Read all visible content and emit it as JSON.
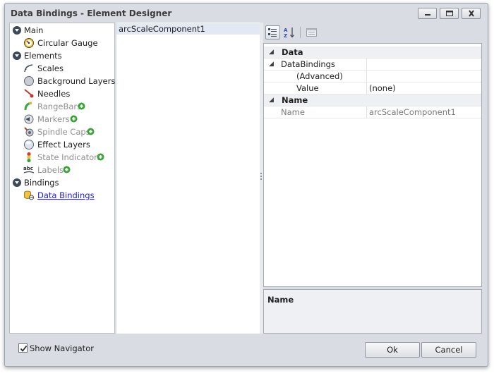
{
  "window": {
    "title": "Data Bindings - Element Designer"
  },
  "titlebar_buttons": [
    {
      "name": "minimize-icon"
    },
    {
      "name": "maximize-icon"
    },
    {
      "name": "close-icon"
    }
  ],
  "navigator": {
    "sections": [
      {
        "label": "Main",
        "items": [
          {
            "label": "Circular Gauge",
            "icon": "circular-gauge-icon",
            "disabled": false,
            "addable": false,
            "link": false
          }
        ]
      },
      {
        "label": "Elements",
        "items": [
          {
            "label": "Scales",
            "icon": "scale-arc-icon",
            "disabled": false,
            "addable": false,
            "link": false
          },
          {
            "label": "Background Layers",
            "icon": "background-layer-icon",
            "disabled": false,
            "addable": false,
            "link": false
          },
          {
            "label": "Needles",
            "icon": "needle-icon",
            "disabled": false,
            "addable": false,
            "link": false
          },
          {
            "label": "RangeBars",
            "icon": "range-bar-icon",
            "disabled": true,
            "addable": true,
            "link": false
          },
          {
            "label": "Markers",
            "icon": "marker-icon",
            "disabled": true,
            "addable": true,
            "link": false
          },
          {
            "label": "Spindle Caps",
            "icon": "spindle-cap-icon",
            "disabled": true,
            "addable": true,
            "link": false
          },
          {
            "label": "Effect Layers",
            "icon": "effect-layer-icon",
            "disabled": false,
            "addable": false,
            "link": false
          },
          {
            "label": "State Indicators",
            "icon": "state-indicator-icon",
            "disabled": true,
            "addable": true,
            "link": false
          },
          {
            "label": "Labels",
            "icon": "labels-abc-icon",
            "disabled": true,
            "addable": true,
            "link": false
          }
        ]
      },
      {
        "label": "Bindings",
        "items": [
          {
            "label": "Data Bindings",
            "icon": "data-binding-icon",
            "disabled": false,
            "addable": false,
            "link": true
          }
        ]
      }
    ]
  },
  "element_list": {
    "items": [
      "arcScaleComponent1"
    ],
    "selected": "arcScaleComponent1"
  },
  "property_toolbar": {
    "buttons": [
      {
        "name": "categorized-view-icon",
        "active": true
      },
      {
        "name": "alphabetical-sort-icon",
        "active": false
      },
      {
        "name": "property-pages-icon",
        "active": false
      }
    ]
  },
  "property_grid": {
    "rows": [
      {
        "type": "category",
        "label": "Data"
      },
      {
        "type": "group",
        "label": "DataBindings",
        "value": ""
      },
      {
        "type": "property",
        "label": "(Advanced)",
        "value": "",
        "indent": true
      },
      {
        "type": "property",
        "label": "Value",
        "value": "(none)",
        "indent": true
      },
      {
        "type": "category",
        "label": "Name"
      },
      {
        "type": "readonly",
        "label": "Name",
        "value": "arcScaleComponent1"
      }
    ]
  },
  "description": {
    "title": "Name"
  },
  "footer": {
    "show_navigator_label": "Show Navigator",
    "show_navigator_checked": true,
    "ok_label": "Ok",
    "cancel_label": "Cancel"
  },
  "colors": {
    "accent_add": "#33a633",
    "link": "#1a1ae6",
    "selection": "#e2e8f4"
  }
}
